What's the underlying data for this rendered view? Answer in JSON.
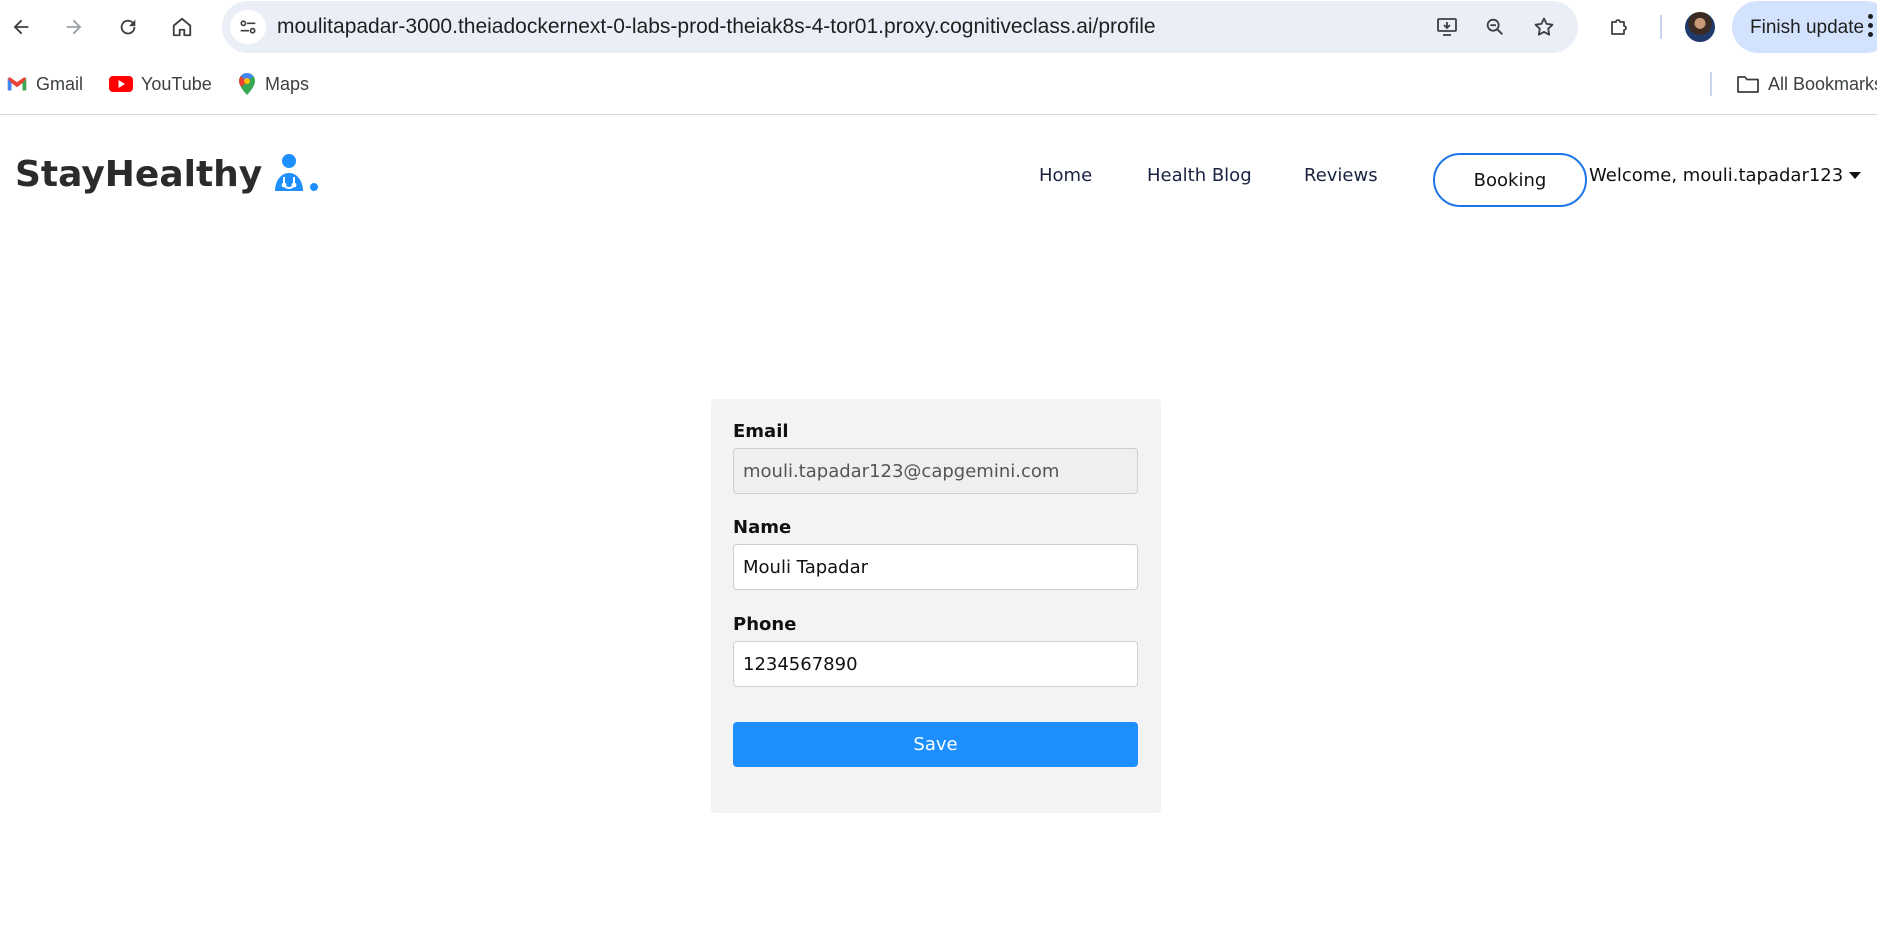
{
  "browser": {
    "url": "moulitapadar-3000.theiadockernext-0-labs-prod-theiak8s-4-tor01.proxy.cognitiveclass.ai/profile",
    "update_label": "Finish update",
    "bookmarks": [
      {
        "label": "Gmail",
        "icon": "gmail-icon"
      },
      {
        "label": "YouTube",
        "icon": "youtube-icon"
      },
      {
        "label": "Maps",
        "icon": "maps-icon"
      }
    ],
    "all_bookmarks_label": "All Bookmarks"
  },
  "navbar": {
    "brand": "StayHealthy",
    "links": [
      "Home",
      "Health Blog",
      "Reviews"
    ],
    "booking_label": "Booking",
    "welcome": "Welcome, mouli.tapadar123"
  },
  "profile_form": {
    "email_label": "Email",
    "email_value": "mouli.tapadar123@capgemini.com",
    "name_label": "Name",
    "name_value": "Mouli Tapadar",
    "phone_label": "Phone",
    "phone_value": "1234567890",
    "save_label": "Save"
  },
  "colors": {
    "accent": "#1e8fff",
    "booking_border": "#1f75e8",
    "card_bg": "#f3f3f3"
  }
}
